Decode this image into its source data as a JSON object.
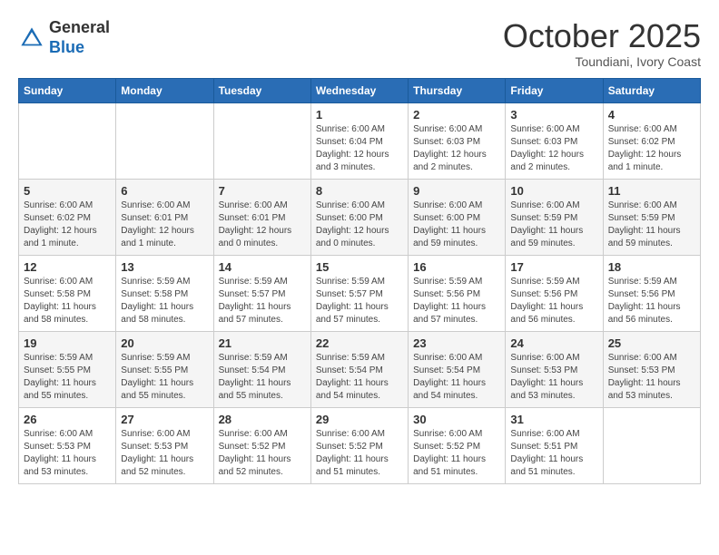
{
  "header": {
    "logo_general": "General",
    "logo_blue": "Blue",
    "month_title": "October 2025",
    "location": "Toundiani, Ivory Coast"
  },
  "weekdays": [
    "Sunday",
    "Monday",
    "Tuesday",
    "Wednesday",
    "Thursday",
    "Friday",
    "Saturday"
  ],
  "weeks": [
    [
      {
        "day": "",
        "info": ""
      },
      {
        "day": "",
        "info": ""
      },
      {
        "day": "",
        "info": ""
      },
      {
        "day": "1",
        "info": "Sunrise: 6:00 AM\nSunset: 6:04 PM\nDaylight: 12 hours and 3 minutes."
      },
      {
        "day": "2",
        "info": "Sunrise: 6:00 AM\nSunset: 6:03 PM\nDaylight: 12 hours and 2 minutes."
      },
      {
        "day": "3",
        "info": "Sunrise: 6:00 AM\nSunset: 6:03 PM\nDaylight: 12 hours and 2 minutes."
      },
      {
        "day": "4",
        "info": "Sunrise: 6:00 AM\nSunset: 6:02 PM\nDaylight: 12 hours and 1 minute."
      }
    ],
    [
      {
        "day": "5",
        "info": "Sunrise: 6:00 AM\nSunset: 6:02 PM\nDaylight: 12 hours and 1 minute."
      },
      {
        "day": "6",
        "info": "Sunrise: 6:00 AM\nSunset: 6:01 PM\nDaylight: 12 hours and 1 minute."
      },
      {
        "day": "7",
        "info": "Sunrise: 6:00 AM\nSunset: 6:01 PM\nDaylight: 12 hours and 0 minutes."
      },
      {
        "day": "8",
        "info": "Sunrise: 6:00 AM\nSunset: 6:00 PM\nDaylight: 12 hours and 0 minutes."
      },
      {
        "day": "9",
        "info": "Sunrise: 6:00 AM\nSunset: 6:00 PM\nDaylight: 11 hours and 59 minutes."
      },
      {
        "day": "10",
        "info": "Sunrise: 6:00 AM\nSunset: 5:59 PM\nDaylight: 11 hours and 59 minutes."
      },
      {
        "day": "11",
        "info": "Sunrise: 6:00 AM\nSunset: 5:59 PM\nDaylight: 11 hours and 59 minutes."
      }
    ],
    [
      {
        "day": "12",
        "info": "Sunrise: 6:00 AM\nSunset: 5:58 PM\nDaylight: 11 hours and 58 minutes."
      },
      {
        "day": "13",
        "info": "Sunrise: 5:59 AM\nSunset: 5:58 PM\nDaylight: 11 hours and 58 minutes."
      },
      {
        "day": "14",
        "info": "Sunrise: 5:59 AM\nSunset: 5:57 PM\nDaylight: 11 hours and 57 minutes."
      },
      {
        "day": "15",
        "info": "Sunrise: 5:59 AM\nSunset: 5:57 PM\nDaylight: 11 hours and 57 minutes."
      },
      {
        "day": "16",
        "info": "Sunrise: 5:59 AM\nSunset: 5:56 PM\nDaylight: 11 hours and 57 minutes."
      },
      {
        "day": "17",
        "info": "Sunrise: 5:59 AM\nSunset: 5:56 PM\nDaylight: 11 hours and 56 minutes."
      },
      {
        "day": "18",
        "info": "Sunrise: 5:59 AM\nSunset: 5:56 PM\nDaylight: 11 hours and 56 minutes."
      }
    ],
    [
      {
        "day": "19",
        "info": "Sunrise: 5:59 AM\nSunset: 5:55 PM\nDaylight: 11 hours and 55 minutes."
      },
      {
        "day": "20",
        "info": "Sunrise: 5:59 AM\nSunset: 5:55 PM\nDaylight: 11 hours and 55 minutes."
      },
      {
        "day": "21",
        "info": "Sunrise: 5:59 AM\nSunset: 5:54 PM\nDaylight: 11 hours and 55 minutes."
      },
      {
        "day": "22",
        "info": "Sunrise: 5:59 AM\nSunset: 5:54 PM\nDaylight: 11 hours and 54 minutes."
      },
      {
        "day": "23",
        "info": "Sunrise: 6:00 AM\nSunset: 5:54 PM\nDaylight: 11 hours and 54 minutes."
      },
      {
        "day": "24",
        "info": "Sunrise: 6:00 AM\nSunset: 5:53 PM\nDaylight: 11 hours and 53 minutes."
      },
      {
        "day": "25",
        "info": "Sunrise: 6:00 AM\nSunset: 5:53 PM\nDaylight: 11 hours and 53 minutes."
      }
    ],
    [
      {
        "day": "26",
        "info": "Sunrise: 6:00 AM\nSunset: 5:53 PM\nDaylight: 11 hours and 53 minutes."
      },
      {
        "day": "27",
        "info": "Sunrise: 6:00 AM\nSunset: 5:53 PM\nDaylight: 11 hours and 52 minutes."
      },
      {
        "day": "28",
        "info": "Sunrise: 6:00 AM\nSunset: 5:52 PM\nDaylight: 11 hours and 52 minutes."
      },
      {
        "day": "29",
        "info": "Sunrise: 6:00 AM\nSunset: 5:52 PM\nDaylight: 11 hours and 51 minutes."
      },
      {
        "day": "30",
        "info": "Sunrise: 6:00 AM\nSunset: 5:52 PM\nDaylight: 11 hours and 51 minutes."
      },
      {
        "day": "31",
        "info": "Sunrise: 6:00 AM\nSunset: 5:51 PM\nDaylight: 11 hours and 51 minutes."
      },
      {
        "day": "",
        "info": ""
      }
    ]
  ]
}
